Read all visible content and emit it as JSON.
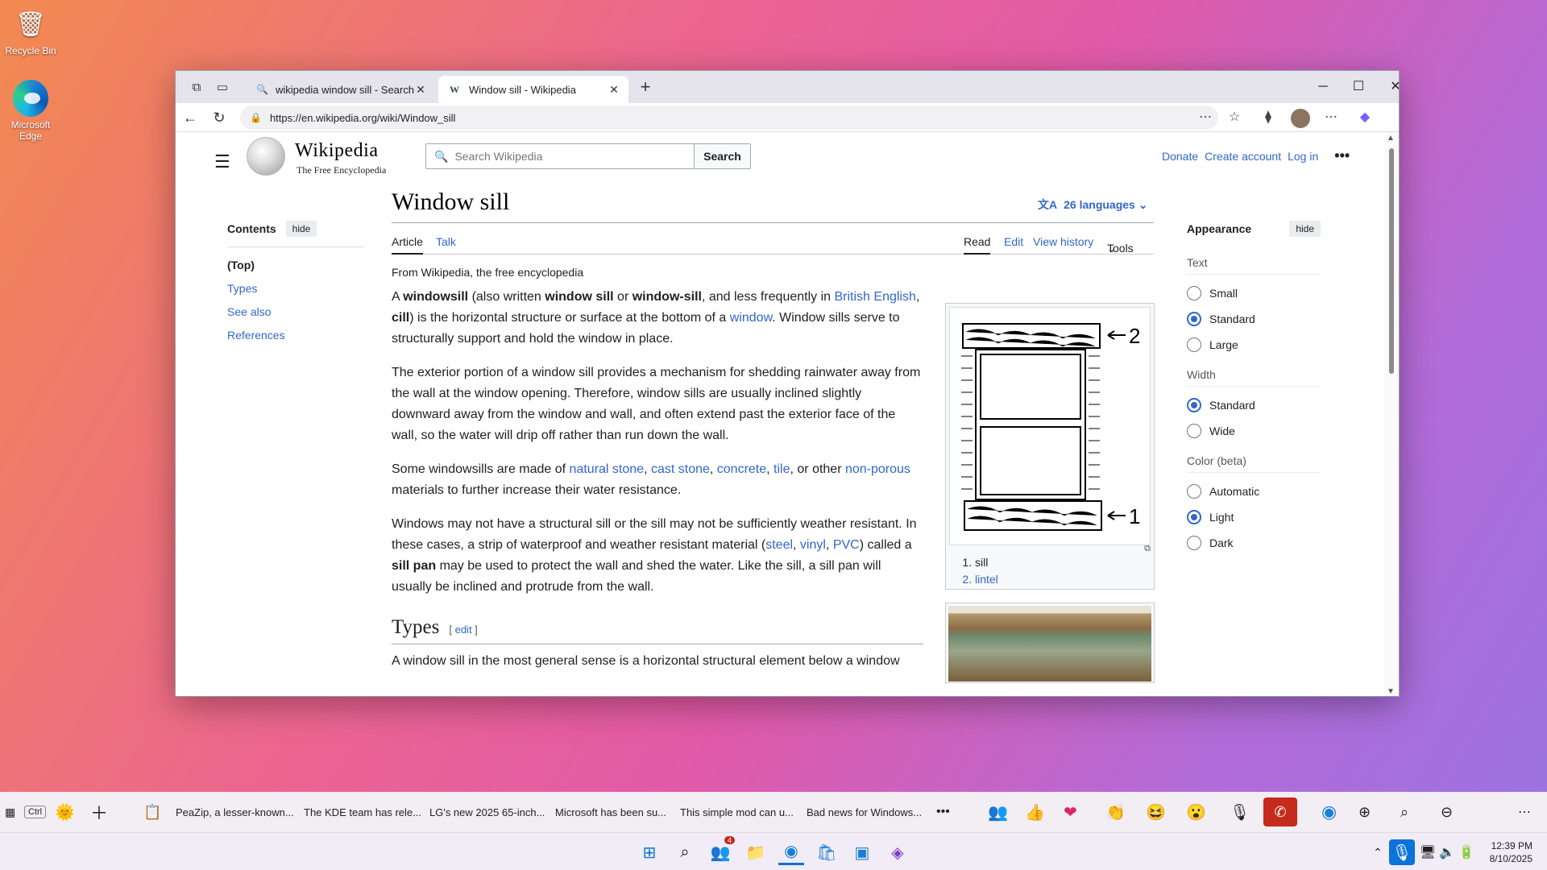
{
  "desktop": {
    "recycle_label": "Recycle Bin",
    "edge_label": "Microsoft Edge"
  },
  "browser": {
    "tabs": [
      {
        "title": "wikipedia window sill - Search",
        "active": false
      },
      {
        "title": "Window sill - Wikipedia",
        "active": true
      }
    ],
    "url": "https://en.wikipedia.org/wiki/Window_sill"
  },
  "wiki": {
    "wordmark": "Wikipedia",
    "tagline": "The Free Encyclopedia",
    "search_placeholder": "Search Wikipedia",
    "search_button": "Search",
    "user_links": {
      "donate": "Donate",
      "create": "Create account",
      "login": "Log in"
    },
    "toc": {
      "title": "Contents",
      "hide": "hide",
      "items": [
        "(Top)",
        "Types",
        "See also",
        "References"
      ]
    },
    "title": "Window sill",
    "languages": "26 languages",
    "tabs": {
      "article": "Article",
      "talk": "Talk",
      "read": "Read",
      "edit": "Edit",
      "history": "View history",
      "tools": "Tools"
    },
    "from": "From Wikipedia, the free encyclopedia",
    "figure_captions": [
      "sill",
      "lintel"
    ],
    "types_heading": "Types",
    "edit_label": "edit",
    "types_first": "A window sill in the most general sense is a horizontal structural element below a window",
    "appearance": {
      "title": "Appearance",
      "hide": "hide",
      "text_label": "Text",
      "text_opts": [
        "Small",
        "Standard",
        "Large"
      ],
      "width_label": "Width",
      "width_opts": [
        "Standard",
        "Wide"
      ],
      "color_label": "Color (beta)",
      "color_opts": [
        "Automatic",
        "Light",
        "Dark"
      ]
    }
  },
  "newsbar": {
    "items": [
      "PeaZip, a lesser-known...",
      "The KDE team has rele...",
      "LG's new 2025 65-inch...",
      "Microsoft has been su...",
      "This simple mod can u...",
      "Bad news for Windows..."
    ],
    "ctrl": "Ctrl"
  },
  "taskbar": {
    "time": "12:39 PM",
    "date": "8/10/2025",
    "teams_badge": "4"
  }
}
